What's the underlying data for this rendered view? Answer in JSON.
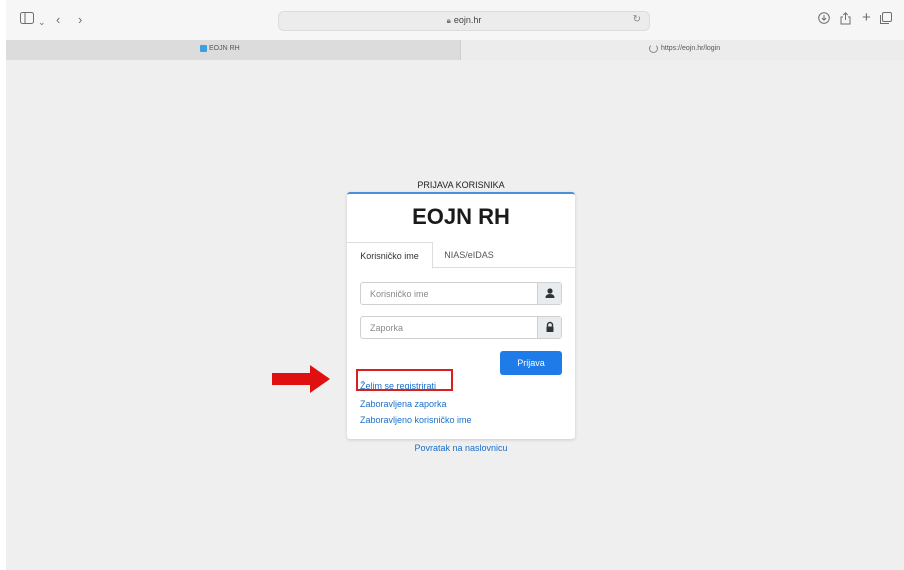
{
  "browser": {
    "address": "eojn.hr",
    "tabs": [
      {
        "label": "EOJN RH"
      },
      {
        "label": "https://eojn.hr/login"
      }
    ]
  },
  "login": {
    "heading": "PRIJAVA KORISNIKA",
    "brand": "EOJN RH",
    "tabs": [
      "Korisničko ime",
      "NIAS/eIDAS"
    ],
    "username_placeholder": "Korisničko ime",
    "password_placeholder": "Zaporka",
    "submit_label": "Prijava",
    "links": {
      "register": "Želim se registrirati",
      "forgot_password": "Zaboravljena zaporka",
      "forgot_username": "Zaboravljeno korisničko ime"
    },
    "back_link": "Povratak na naslovnicu"
  },
  "colors": {
    "primary": "#1e7be8",
    "link": "#1a6fc9",
    "highlight": "#d92020",
    "arrow": "#e01010"
  }
}
